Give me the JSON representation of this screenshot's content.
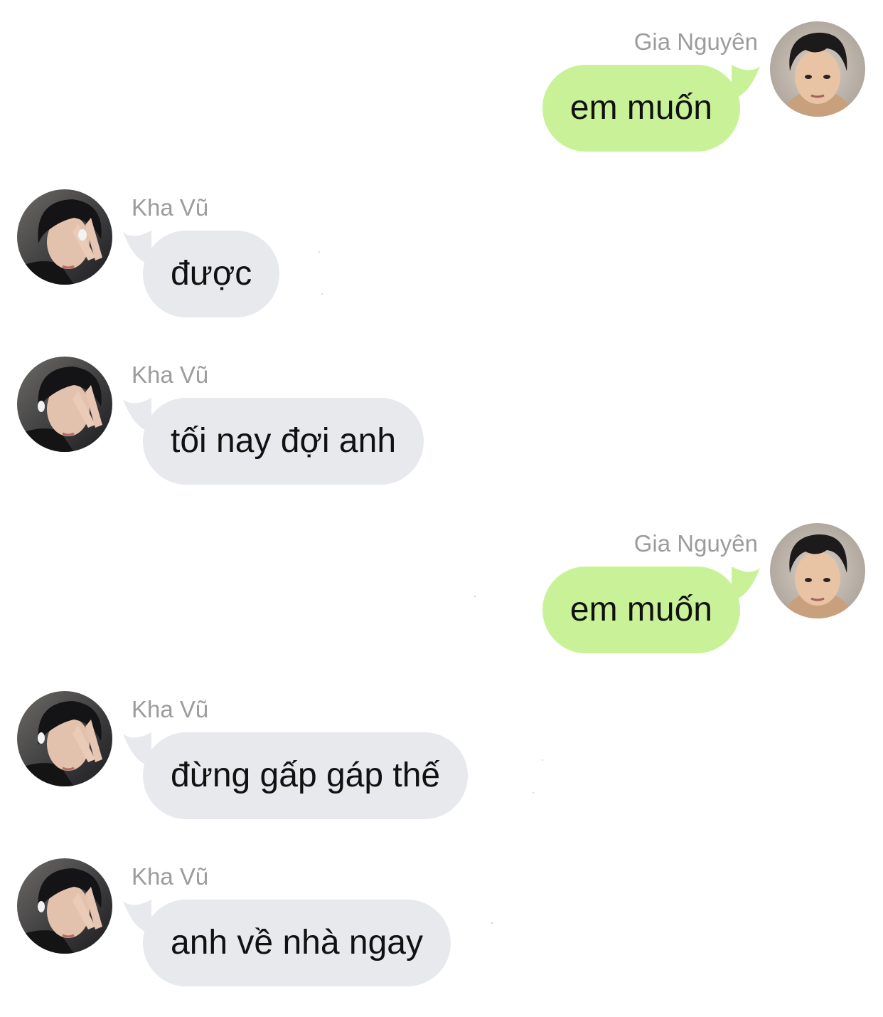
{
  "colors": {
    "incoming_bubble": "#e7e9ec",
    "outgoing_bubble": "#c9f298",
    "sender_name": "#9c9c9c",
    "message_text": "#111111"
  },
  "messages": [
    {
      "side": "right",
      "sender": "Gia Nguyên",
      "text": "em muốn",
      "avatar": "avatar-gia-nguyen"
    },
    {
      "side": "left",
      "sender": "Kha Vũ",
      "text": "được",
      "avatar": "avatar-kha-vu"
    },
    {
      "side": "left",
      "sender": "Kha Vũ",
      "text": "tối nay đợi anh",
      "avatar": "avatar-kha-vu"
    },
    {
      "side": "right",
      "sender": "Gia Nguyên",
      "text": "em muốn",
      "avatar": "avatar-gia-nguyen"
    },
    {
      "side": "left",
      "sender": "Kha Vũ",
      "text": "đừng gấp gáp thế",
      "avatar": "avatar-kha-vu"
    },
    {
      "side": "left",
      "sender": "Kha Vũ",
      "text": "anh về nhà ngay",
      "avatar": "avatar-kha-vu"
    }
  ]
}
